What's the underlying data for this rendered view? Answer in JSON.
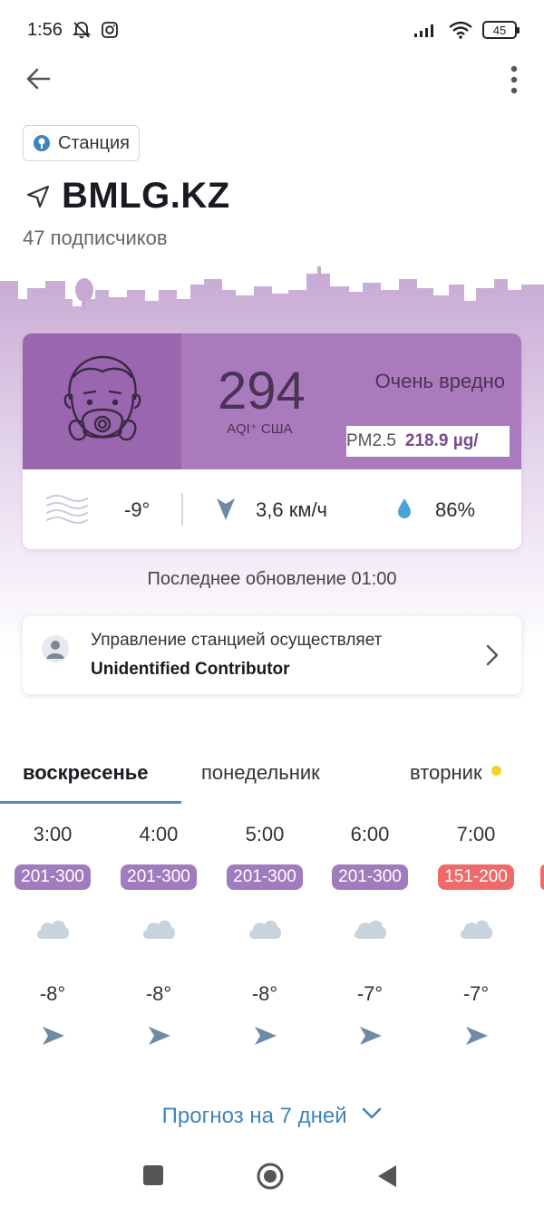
{
  "status_bar": {
    "time": "1:56",
    "battery": "45"
  },
  "station": {
    "chip_label": "Станция",
    "title": "BMLG.KZ",
    "subscribers": "47 подписчиков"
  },
  "aqi": {
    "value": "294",
    "unit": "AQI⁺ США",
    "level": "Очень вредно",
    "pm_label": "PM2.5",
    "pm_value": "218.9 µg/",
    "color_main": "#a97bbd",
    "color_dark": "#9966af"
  },
  "weather": {
    "temperature": "-9°",
    "wind": "3,6 км/ч",
    "humidity": "86%"
  },
  "last_update": "Последнее обновление 01:00",
  "contributor": {
    "line1": "Управление станцией осуществляет",
    "line2": "Unidentified Contributor"
  },
  "tabs": [
    {
      "label": "воскресенье"
    },
    {
      "label": "понедельник"
    },
    {
      "label": "вторник"
    }
  ],
  "hours": [
    {
      "time": "3:00",
      "range": "201-300",
      "color": "#a07bbd",
      "temp": "-8°"
    },
    {
      "time": "4:00",
      "range": "201-300",
      "color": "#a07bbd",
      "temp": "-8°"
    },
    {
      "time": "5:00",
      "range": "201-300",
      "color": "#a07bbd",
      "temp": "-8°"
    },
    {
      "time": "6:00",
      "range": "201-300",
      "color": "#a07bbd",
      "temp": "-7°"
    },
    {
      "time": "7:00",
      "range": "151-200",
      "color": "#ef6a6a",
      "temp": "-7°"
    }
  ],
  "forecast_button": "Прогноз на 7 дней"
}
